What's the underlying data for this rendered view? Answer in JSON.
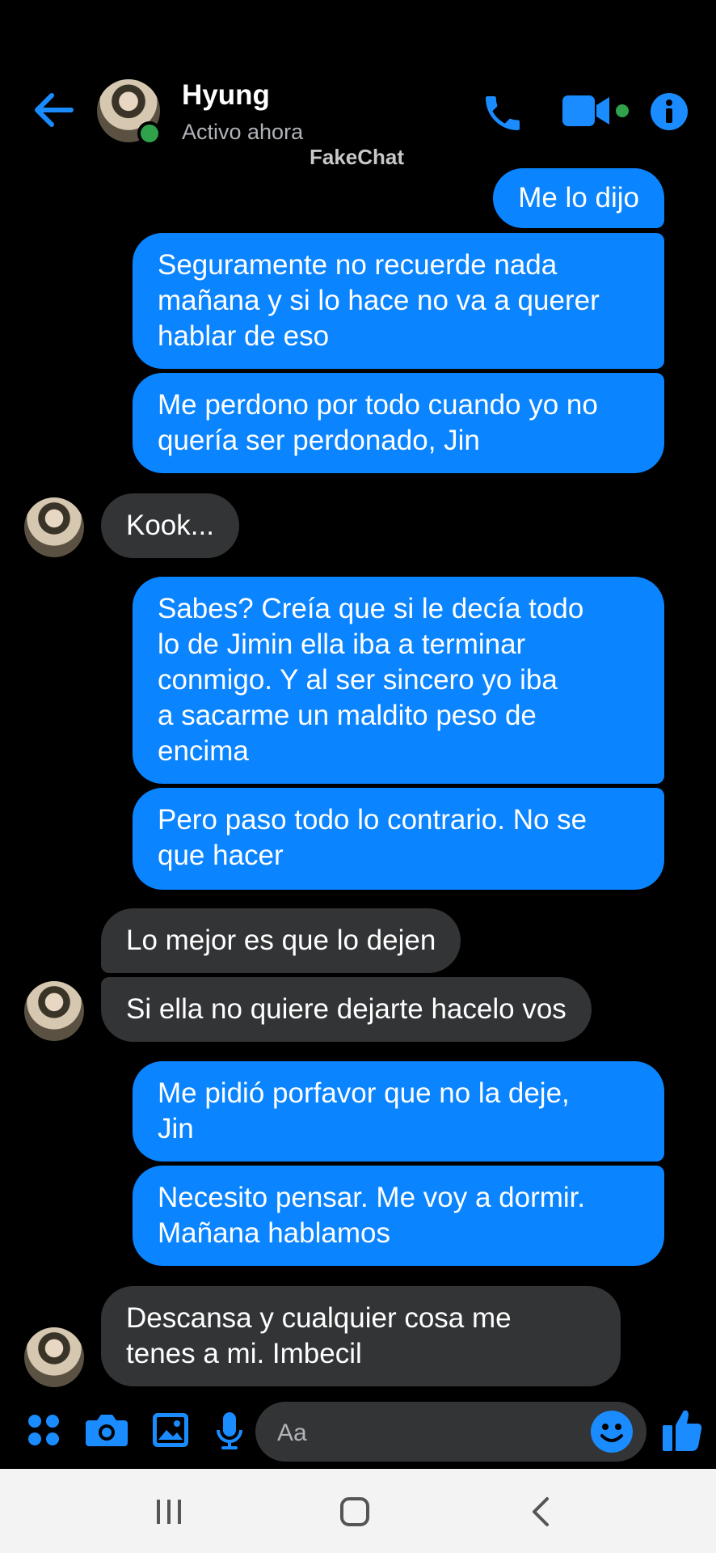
{
  "header": {
    "title": "Hyung",
    "status": "Activo ahora",
    "watermark": "FakeChat"
  },
  "messages": [
    {
      "from": "me",
      "text": "Me lo dijo"
    },
    {
      "from": "me",
      "text": "Seguramente no recuerde nada\nmañana y si lo hace no va a querer\nhablar de eso"
    },
    {
      "from": "me",
      "text": "Me perdono por todo cuando yo no\nquería ser perdonado, Jin"
    },
    {
      "from": "them",
      "text": "Kook..."
    },
    {
      "from": "me",
      "text": "Sabes? Creía que si le decía todo\nlo de Jimin ella iba a terminar\nconmigo. Y al ser sincero yo iba\na sacarme un maldito peso de\nencima"
    },
    {
      "from": "me",
      "text": "Pero paso todo lo contrario. No se\nque hacer"
    },
    {
      "from": "them",
      "text": "Lo mejor es que lo dejen"
    },
    {
      "from": "them",
      "text": "Si ella no quiere dejarte hacelo vos"
    },
    {
      "from": "me",
      "text": "Me pidió porfavor que no la deje,\nJin"
    },
    {
      "from": "me",
      "text": "Necesito pensar. Me voy a dormir.\nMañana hablamos"
    },
    {
      "from": "them",
      "text": "Descansa y cualquier cosa me\ntenes a mi. Imbecil"
    }
  ],
  "composer": {
    "placeholder": "Aa"
  },
  "colors": {
    "accent": "#0a84ff",
    "incoming_bubble": "#333436",
    "background": "#000000",
    "presence": "#31a24c"
  },
  "icons": {
    "back": "back-arrow-icon",
    "call": "phone-icon",
    "video": "video-camera-icon",
    "info": "info-icon",
    "apps": "apps-grid-icon",
    "camera": "camera-icon",
    "gallery": "image-icon",
    "mic": "microphone-icon",
    "emoji": "emoji-icon",
    "like": "thumbs-up-icon",
    "nav_recent": "recent-apps-icon",
    "nav_home": "home-icon",
    "nav_back": "nav-back-icon"
  }
}
